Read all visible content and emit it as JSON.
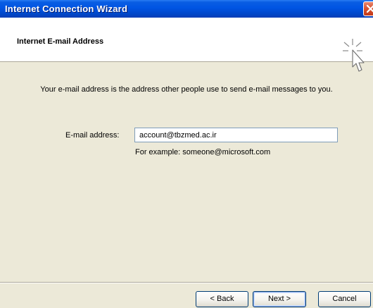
{
  "window": {
    "title": "Internet Connection Wizard"
  },
  "header": {
    "title": "Internet E-mail Address",
    "icon": "wizard-cursor-icon"
  },
  "content": {
    "description": "Your e-mail address is the address other people use to send e-mail messages to you.",
    "email_label": "E-mail address:",
    "email_value": "account@tbzmed.ac.ir",
    "example": "For example: someone@microsoft.com"
  },
  "buttons": {
    "back": "< Back",
    "next": "Next >",
    "cancel": "Cancel"
  },
  "colors": {
    "titlebar": "#0054e3",
    "close": "#d8512f",
    "background": "#ece9d8"
  }
}
